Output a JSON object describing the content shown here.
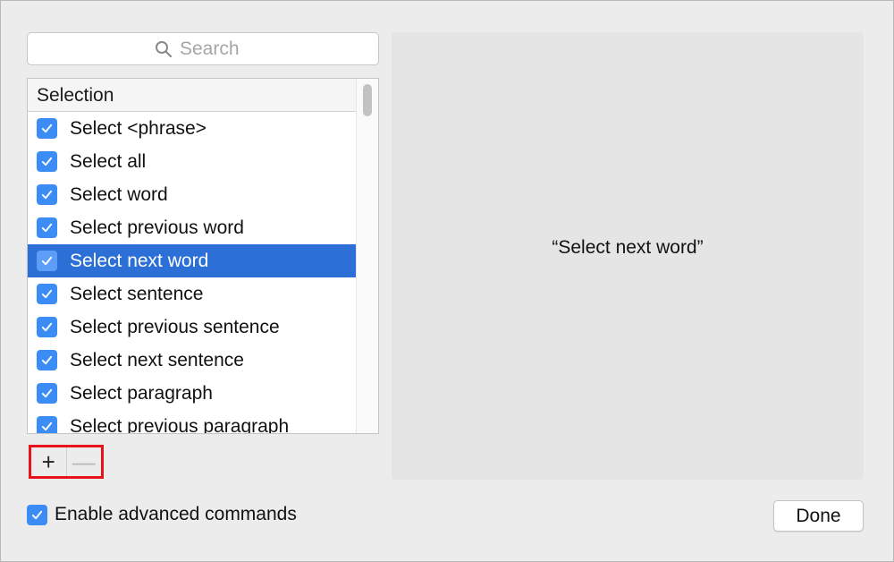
{
  "search": {
    "placeholder": "Search",
    "icon": "search-icon"
  },
  "list": {
    "header": "Selection",
    "items": [
      {
        "label": "Select <phrase>",
        "checked": true
      },
      {
        "label": "Select all",
        "checked": true
      },
      {
        "label": "Select word",
        "checked": true
      },
      {
        "label": "Select previous word",
        "checked": true
      },
      {
        "label": "Select next word",
        "checked": true,
        "selected": true
      },
      {
        "label": "Select sentence",
        "checked": true
      },
      {
        "label": "Select previous sentence",
        "checked": true
      },
      {
        "label": "Select next sentence",
        "checked": true
      },
      {
        "label": "Select paragraph",
        "checked": true
      },
      {
        "label": "Select previous paragraph",
        "checked": true
      }
    ]
  },
  "toolbar": {
    "add_label": "+",
    "remove_label": "—"
  },
  "preview": {
    "text": "“Select next word”"
  },
  "footer": {
    "advanced_label": "Enable advanced commands",
    "advanced_checked": true,
    "done_label": "Done"
  },
  "colors": {
    "accent": "#3c8cf5",
    "selection": "#2c6fd6",
    "highlight_box": "#e8141b"
  }
}
